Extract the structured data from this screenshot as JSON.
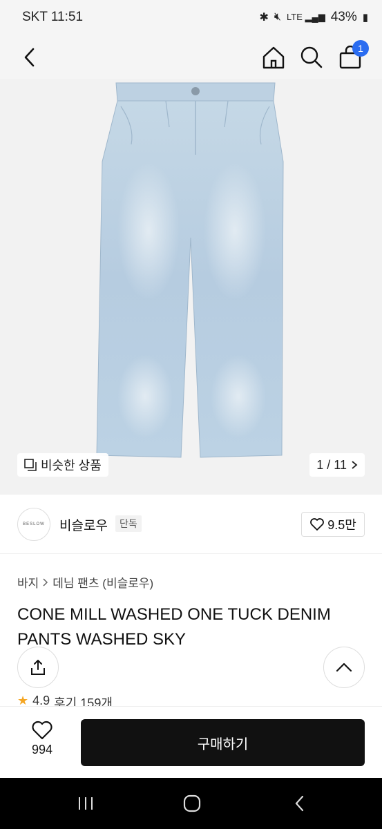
{
  "status_bar": {
    "carrier_time": "SKT 11:51",
    "battery": "43%"
  },
  "header": {
    "back_icon": "chevron-left-icon",
    "home_icon": "home-icon",
    "search_icon": "search-icon",
    "cart_icon": "shopping-bag-icon",
    "cart_count": "1"
  },
  "gallery": {
    "similar_label": "비슷한 상품",
    "page_indicator": "1 / 11"
  },
  "brand": {
    "logo_text": "BESLOW",
    "name": "비슬로우",
    "badge": "단독",
    "likes": "9.5만"
  },
  "breadcrumb": {
    "category": "바지",
    "subcategory": "데님 팬츠 (비슬로우)"
  },
  "product": {
    "title": "CONE MILL WASHED ONE TUCK DENIM PANTS WASHED SKY"
  },
  "rating": {
    "score": "4.9",
    "reviews": "후기 159개"
  },
  "bottom_bar": {
    "wish_count": "994",
    "buy_label": "구매하기"
  },
  "colors": {
    "accent": "#2a6cf0",
    "denim": "#b9cfe0",
    "buy_button": "#111111"
  }
}
